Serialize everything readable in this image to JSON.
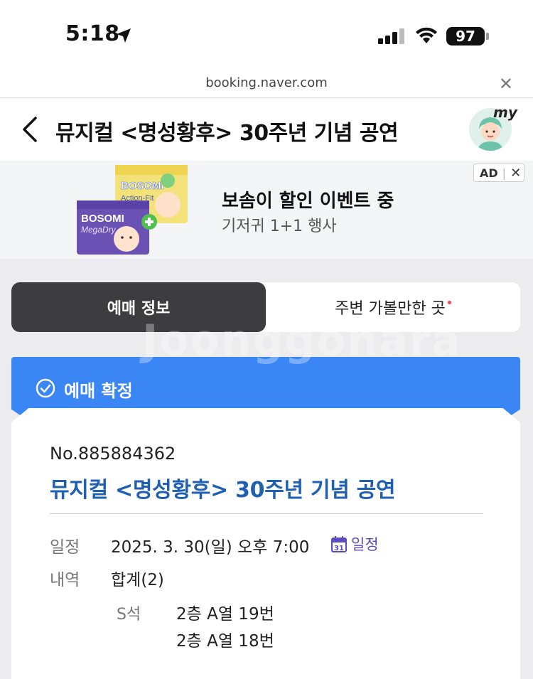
{
  "status_bar": {
    "time": "5:18",
    "battery": "97"
  },
  "browser": {
    "url": "booking.naver.com",
    "close_symbol": "✕"
  },
  "header": {
    "title": "뮤지컬 <명성황후> 30주년 기념 공연",
    "my_label": "my"
  },
  "ad": {
    "title": "보솜이 할인 이벤트 중",
    "subtitle": "기저귀 1+1 행사",
    "badge_label": "AD",
    "badge_close": "✕",
    "product_brand_top": "BOSOMI",
    "product_line_top": "Action-Fit",
    "product_brand_front": "BOSOMI",
    "product_line_front": "MegaDry"
  },
  "tabs": [
    {
      "label": "예매 정보",
      "active": true
    },
    {
      "label": "주변 가볼만한 곳",
      "active": false,
      "has_dot": true
    }
  ],
  "status": {
    "label": "예매 확정"
  },
  "booking": {
    "number": "No.885884362",
    "title": "뮤지컬 <명성황후> 30주년 기념 공연",
    "date_label": "일정",
    "date_value": "2025. 3. 30(일) 오후 7:00",
    "calendar_icon_text": "31",
    "calendar_link": "일정",
    "detail_label": "내역",
    "detail_value": "합계(2)",
    "seat_grade": "S석",
    "seats": [
      "2층 A열 19번",
      "2층 A열 18번"
    ]
  },
  "watermark": "Joonggonara",
  "colors": {
    "confirm_blue": "#3a86f5",
    "title_blue": "#1f5fb4",
    "tab_dark": "#3d3d3f",
    "calendar_purple": "#5a4bc0"
  }
}
